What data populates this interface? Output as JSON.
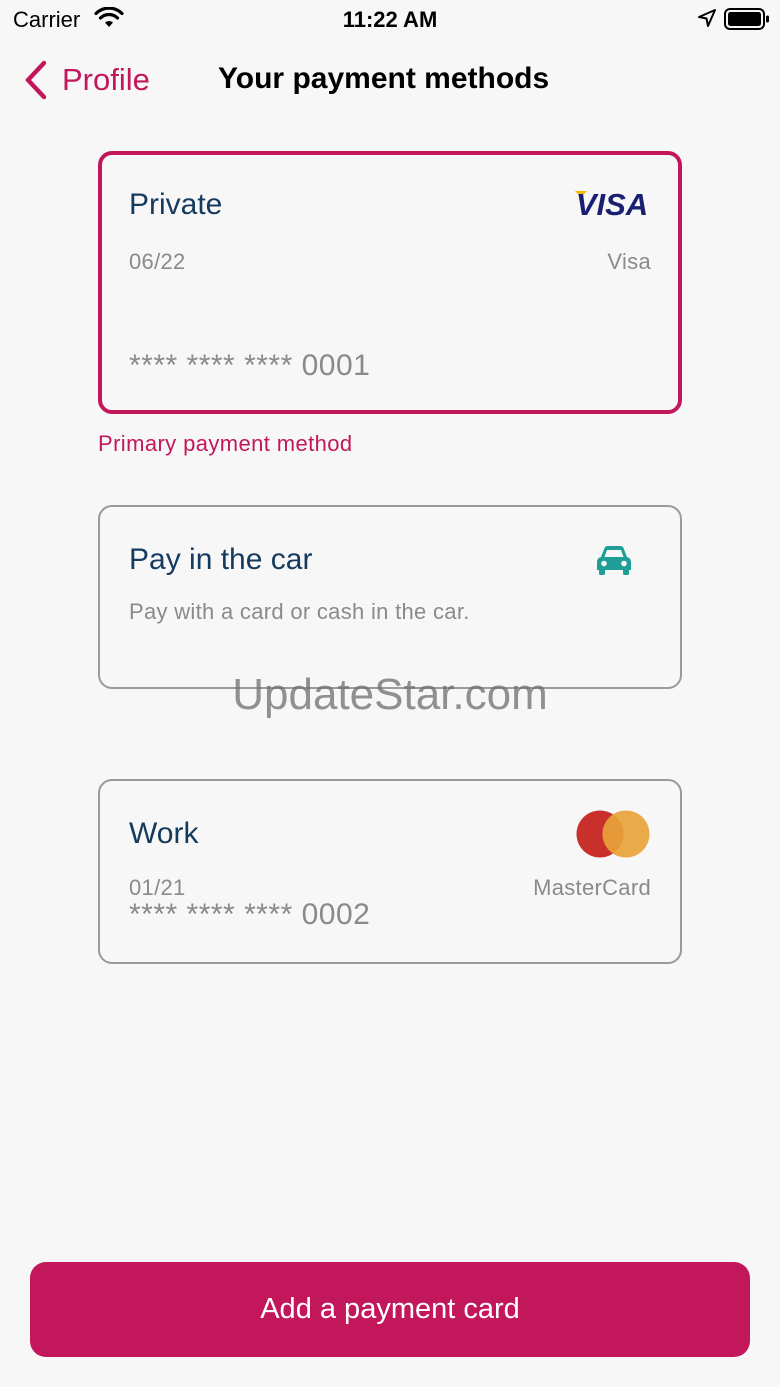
{
  "status_bar": {
    "carrier": "Carrier",
    "time": "11:22 AM",
    "icons": [
      "wifi-icon",
      "location-arrow-icon",
      "battery-icon"
    ]
  },
  "nav": {
    "back_label": "Profile",
    "title": "Your payment methods"
  },
  "cards": [
    {
      "title": "Private",
      "expiry": "06/22",
      "brand": "Visa",
      "brand_logo_text": "VISA",
      "number": "**** **** **** 0001",
      "selected": true
    },
    {
      "title": "Pay in the car",
      "subtitle": "Pay with a card or cash in the car.",
      "icon": "car-icon"
    },
    {
      "title": "Work",
      "expiry": "01/21",
      "brand": "MasterCard",
      "number": "**** **** **** 0002"
    }
  ],
  "primary_label": "Primary payment method",
  "watermark": "UpdateStar.com",
  "add_button_label": "Add a payment card",
  "colors": {
    "accent": "#c2185b",
    "title_text": "#143a5e",
    "secondary_text": "#8a8a8a",
    "car_icon": "#1e9e97",
    "visa_blue": "#1a1f71",
    "visa_gold": "#f7b600",
    "mastercard_red": "#c9302c",
    "mastercard_orange": "#e8a33a"
  }
}
